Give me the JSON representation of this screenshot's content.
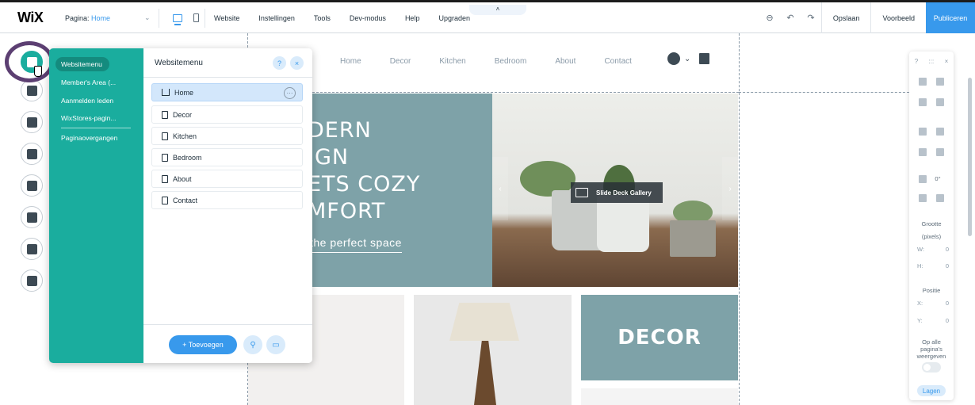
{
  "topbar": {
    "logo": "WiX",
    "page_label": "Pagina:",
    "page_value": "Home",
    "menu": [
      "Website",
      "Instellingen",
      "Tools",
      "Dev-modus",
      "Help",
      "Upgraden"
    ],
    "handle": "˄",
    "save": "Opslaan",
    "preview": "Voorbeeld",
    "publish": "Publiceren",
    "accent": "#3899ec"
  },
  "site": {
    "nav": [
      "Home",
      "Decor",
      "Kitchen",
      "Bedroom",
      "About",
      "Contact"
    ],
    "hero_lines": [
      "DERN",
      "IGN",
      "ETS COZY",
      "MFORT"
    ],
    "hero_sub": "the perfect space",
    "gallery_label": "Slide Deck Gallery",
    "decor_title": "DECOR",
    "brand_color": "#7ea2a8"
  },
  "left_panel": {
    "categories": [
      "Websitemenu",
      "Member's Area (...",
      "Aanmelden leden",
      "WixStores-pagin...",
      "Paginaovergangen"
    ],
    "title": "Websitemenu",
    "help": "?",
    "close": "×",
    "pages": [
      {
        "label": "Home",
        "icon": "home-icon"
      },
      {
        "label": "Decor",
        "icon": "page-icon"
      },
      {
        "label": "Kitchen",
        "icon": "page-icon"
      },
      {
        "label": "Bedroom",
        "icon": "page-icon"
      },
      {
        "label": "About",
        "icon": "page-icon"
      },
      {
        "label": "Contact",
        "icon": "page-icon"
      }
    ],
    "more": "···",
    "add_button": "+ Toevoegen",
    "panel_color": "#1aad9e"
  },
  "inspector": {
    "top": [
      "?",
      ":::",
      "×"
    ],
    "size_title": "Grootte",
    "size_unit": "(pixels)",
    "w_label": "W:",
    "w_value": "0",
    "h_label": "H:",
    "h_value": "0",
    "pos_title": "Positie",
    "x_label": "X:",
    "x_value": "0",
    "y_label": "Y:",
    "y_value": "0",
    "rotation": "0°",
    "show_all_line1": "Op alle",
    "show_all_line2": "pagina's",
    "show_all_line3": "weergeven",
    "layers": "Lagen"
  }
}
